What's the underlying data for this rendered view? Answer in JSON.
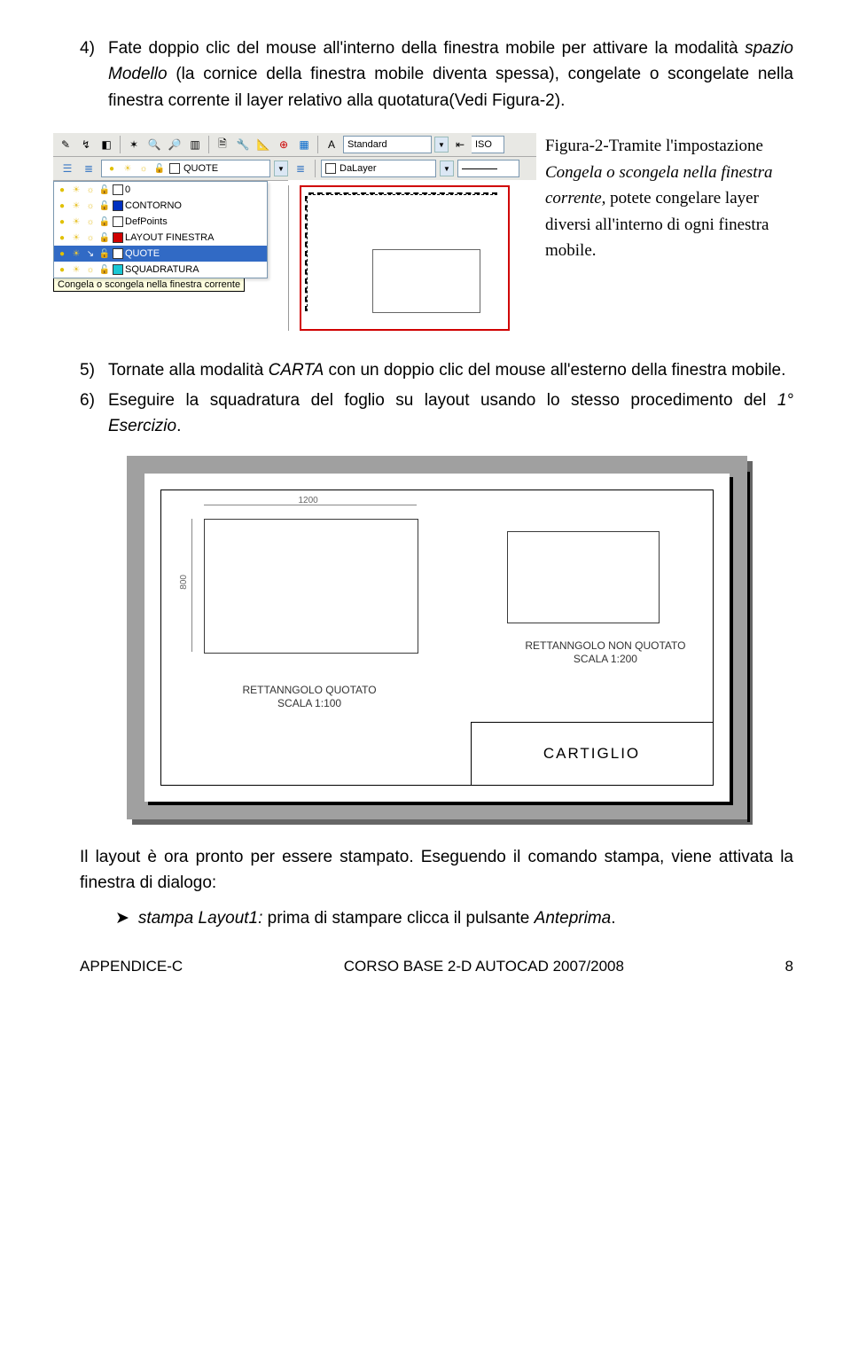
{
  "step4": {
    "num": "4)",
    "text_parts": {
      "a": "Fate doppio clic del mouse all'interno della finestra mobile per attivare la modalità ",
      "b": "spazio Modello",
      "c": " (la cornice della finestra mobile diventa spessa), congelate o scongelate nella finestra corrente il layer relativo alla quotatura(Vedi Figura-2)."
    }
  },
  "fig1": {
    "toolbar": {
      "style_label": "Standard",
      "iso_label": "ISO",
      "bylayer_label": "DaLayer"
    },
    "layers": [
      {
        "name": "QUOTE",
        "color": "white"
      },
      {
        "name": "0",
        "color": "white"
      },
      {
        "name": "CONTORNO",
        "color": "blue"
      },
      {
        "name": "DefPoints",
        "color": "white"
      },
      {
        "name": "LAYOUT FINESTRA",
        "color": "red"
      },
      {
        "name": "QUOTE",
        "color": "white",
        "selected": true
      },
      {
        "name": "SQUADRATURA",
        "color": "cyan"
      }
    ],
    "tooltip": "Congela o scongela nella finestra corrente",
    "caption_parts": {
      "a": "Figura-2-Tramite l'impostazione ",
      "b": "Congela o scongela nella finestra corrente,",
      "c": " potete congelare layer diversi all'interno di ogni finestra mobile."
    }
  },
  "step5": {
    "num": "5)",
    "text_parts": {
      "a": "Tornate alla modalità ",
      "b": "CARTA",
      "c": " con un doppio clic del mouse all'esterno della finestra mobile."
    }
  },
  "step6": {
    "num": "6)",
    "text_parts": {
      "a": "Eseguire la squadratura del foglio su layout usando lo stesso procedimento del ",
      "b": "1° Esercizio",
      "c": "."
    }
  },
  "fig2": {
    "dim_top": "1200",
    "dim_left": "800",
    "label1_line1": "RETTANNGOLO QUOTATO",
    "label1_line2": "SCALA 1:100",
    "label2_line1": "RETTANNGOLO NON QUOTATO",
    "label2_line2": "SCALA 1:200",
    "cartiglio": "CARTIGLIO"
  },
  "closing": {
    "p": "Il layout è ora pronto per essere stampato. Eseguendo il comando stampa, viene attivata la finestra di dialogo:",
    "bullet_parts": {
      "a": "stampa Layout1:",
      "b": " prima di stampare clicca il pulsante ",
      "c": "Anteprima",
      "d": "."
    }
  },
  "footer": {
    "left": "APPENDICE-C",
    "center": "CORSO BASE 2-D AUTOCAD 2007/2008",
    "right": "8"
  }
}
